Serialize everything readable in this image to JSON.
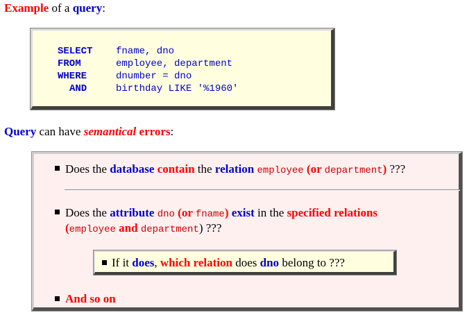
{
  "heading1": {
    "w1": "Example",
    "w2": " of a ",
    "w3": "query",
    "w4": ":"
  },
  "sql": {
    "rows": [
      {
        "keyword": "SELECT",
        "expr": "fname, dno"
      },
      {
        "keyword": "FROM",
        "expr": "employee, department"
      },
      {
        "keyword": "WHERE",
        "expr": "dnumber = dno"
      },
      {
        "keyword": "AND",
        "expr": "birthday LIKE '%1960'"
      }
    ]
  },
  "heading2": {
    "w1": "Query",
    "w2": " can have ",
    "w3": "semantical",
    "w4": " errors",
    "w5": ":"
  },
  "q1": {
    "a": "Does the ",
    "b": "database",
    "c": " ",
    "d": "contain",
    "e": " the ",
    "f": "relation",
    "g": " ",
    "h": "employee",
    "i": " (or ",
    "j": "department",
    "k": ")",
    "l": " ???"
  },
  "q2": {
    "a": "Does the ",
    "b": "attribute",
    "c": " ",
    "d": "dno",
    "e": " (or ",
    "f": "fname",
    "g": ")",
    "h": " ",
    "i": "exist",
    "j": " in the ",
    "k": "specified relations",
    "l2a": "(",
    "l2b": "employee",
    "l2c": " and ",
    "l2d": "department",
    "l2e": ")",
    "l2f": " ???"
  },
  "q3": {
    "a": "If it ",
    "b": "does",
    "c": ", ",
    "d": "which relation",
    "e": " does ",
    "f": "dno",
    "g": " belong to ???"
  },
  "q4": {
    "a": "And so on"
  }
}
